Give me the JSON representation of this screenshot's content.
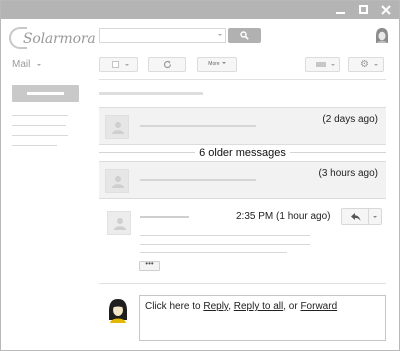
{
  "app": {
    "logo_text": "Solarmora"
  },
  "nav": {
    "mail_label": "Mail"
  },
  "toolbar": {
    "more_label": "More"
  },
  "thread": {
    "message1_time": "(2 days ago)",
    "older_messages": "6 older messages",
    "message2_time": "(3 hours ago)",
    "message3_time": "2:35 PM (1 hour ago)",
    "ellipsis_label": "•••"
  },
  "reply": {
    "prompt_prefix": "Click here to ",
    "reply_link": "Reply",
    "sep1": ", ",
    "reply_all_link": "Reply to all",
    "sep2": ", or ",
    "forward_link": "Forward"
  },
  "colors": {
    "titlebar": "#b4b4b4",
    "collapsed_message_bg": "#f2f2f2",
    "search_button": "#b1b1b1"
  },
  "icons": [
    "minimize-icon",
    "maximize-icon",
    "close-icon",
    "search-icon",
    "user-avatar-icon",
    "refresh-icon",
    "keyboard-icon",
    "gear-icon",
    "reply-icon",
    "chevron-down-icon"
  ]
}
